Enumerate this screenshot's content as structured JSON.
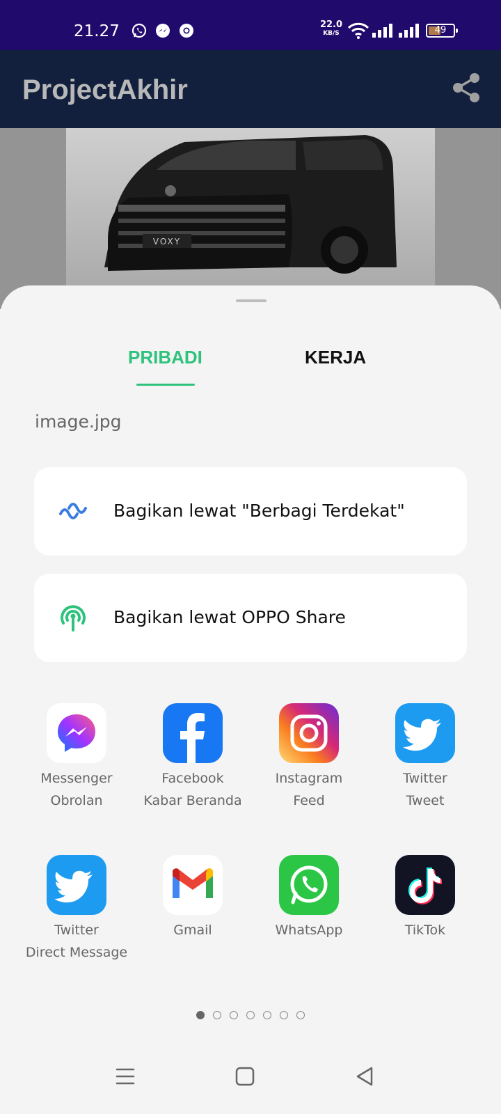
{
  "status_bar": {
    "time": "21.27",
    "network_speed": "22.0",
    "network_speed_unit": "KB/S",
    "battery_percent": "49",
    "battery_level": 0.49,
    "notification_icons": [
      "whatsapp-icon",
      "messenger-icon",
      "chrome-icon"
    ]
  },
  "app_bar": {
    "title": "ProjectAkhir",
    "share_icon": "share-icon"
  },
  "share_sheet": {
    "tabs": [
      {
        "label": "PRIBADI",
        "active": true
      },
      {
        "label": "KERJA",
        "active": false
      }
    ],
    "file_name": "image.jpg",
    "nearby_share": {
      "label": "Bagikan lewat \"Berbagi Terdekat\"",
      "icon": "nearby-share-icon"
    },
    "oppo_share": {
      "label": "Bagikan lewat OPPO Share",
      "icon": "oppo-share-icon"
    },
    "apps": [
      {
        "name": "Messenger",
        "sub": "Obrolan",
        "icon": "messenger-icon"
      },
      {
        "name": "Facebook",
        "sub": "Kabar Beranda",
        "icon": "facebook-icon"
      },
      {
        "name": "Instagram",
        "sub": "Feed",
        "icon": "instagram-icon"
      },
      {
        "name": "Twitter",
        "sub": "Tweet",
        "icon": "twitter-icon"
      },
      {
        "name": "Twitter",
        "sub": "Direct Message",
        "icon": "twitter-icon"
      },
      {
        "name": "Gmail",
        "sub": "",
        "icon": "gmail-icon"
      },
      {
        "name": "WhatsApp",
        "sub": "",
        "icon": "whatsapp-icon"
      },
      {
        "name": "TikTok",
        "sub": "",
        "icon": "tiktok-icon"
      }
    ],
    "page_count": 7,
    "current_page": 1
  },
  "nav_bar": {
    "buttons": [
      "menu-icon",
      "home-icon",
      "back-icon"
    ]
  },
  "colors": {
    "status_bar": "#200a6b",
    "app_bar": "#12203e",
    "accent": "#2fc27d",
    "sheet_bg": "#f4f4f4"
  }
}
